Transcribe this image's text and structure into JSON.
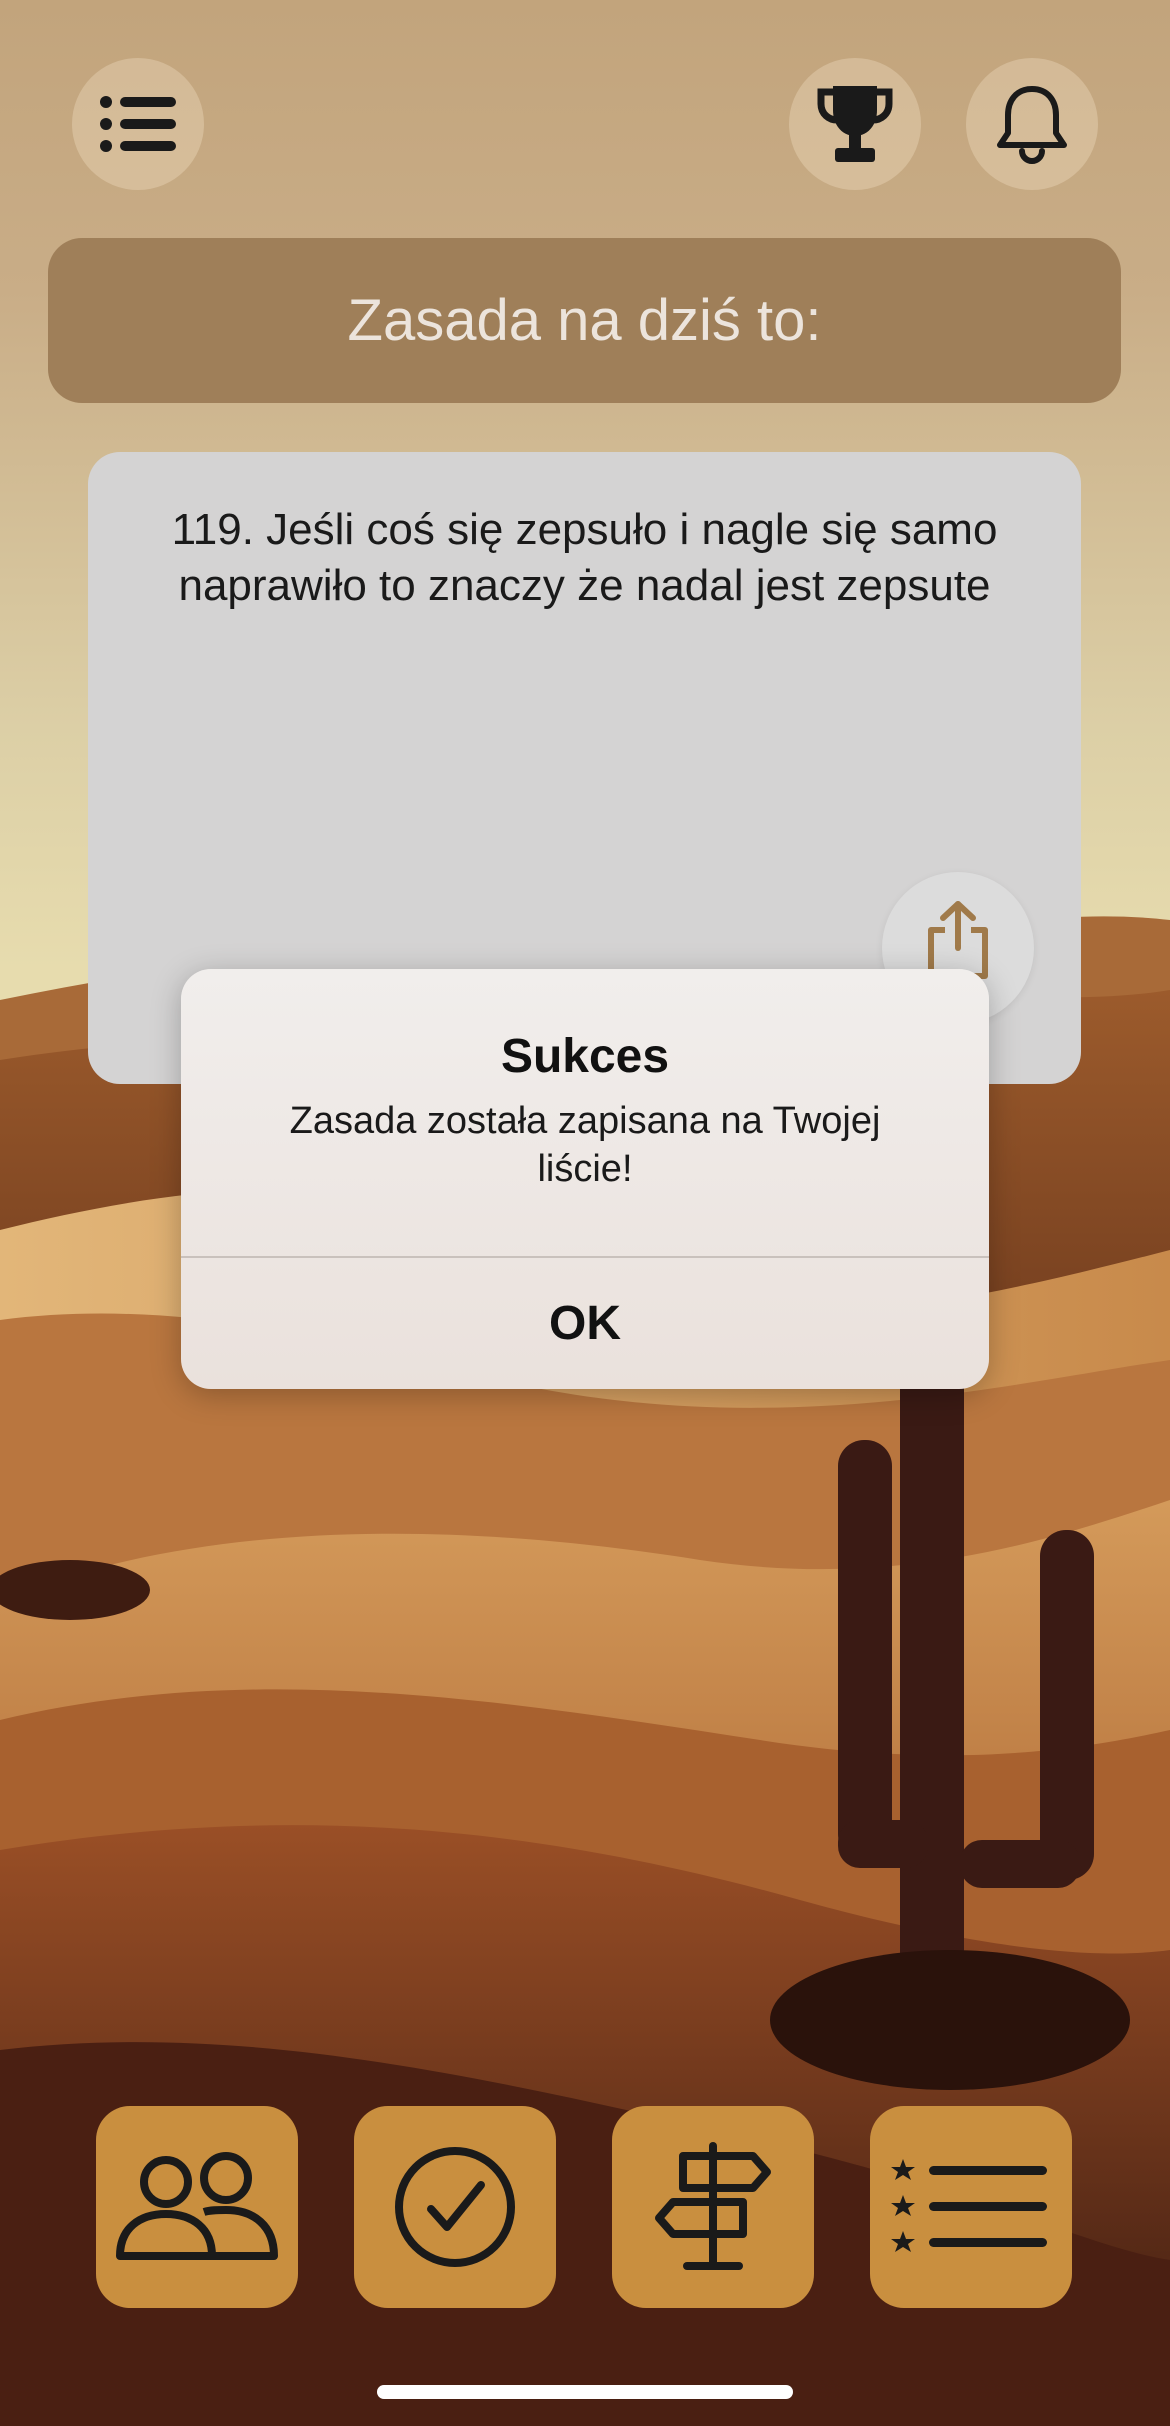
{
  "header": {
    "banner_text": "Zasada na dziś to:"
  },
  "top_bar": {
    "menu_icon": "list-icon",
    "achievements_icon": "trophy-icon",
    "notifications_icon": "bell-icon"
  },
  "rule_card": {
    "text": "119. Jeśli coś się zepsuło i nagle się samo naprawiło to znaczy że nadal jest zepsute",
    "share_icon": "share-icon"
  },
  "alert": {
    "title": "Sukces",
    "message": "Zasada została zapisana na Twojej liście!",
    "ok_label": "OK"
  },
  "bottom_nav": {
    "items": [
      {
        "icon": "people-icon"
      },
      {
        "icon": "checkmark-circle-icon"
      },
      {
        "icon": "signpost-icon"
      },
      {
        "icon": "starred-list-icon"
      }
    ]
  },
  "colors": {
    "accent": "#c98f3f",
    "banner": "#9f7f59",
    "card": "#d4d3d3"
  }
}
